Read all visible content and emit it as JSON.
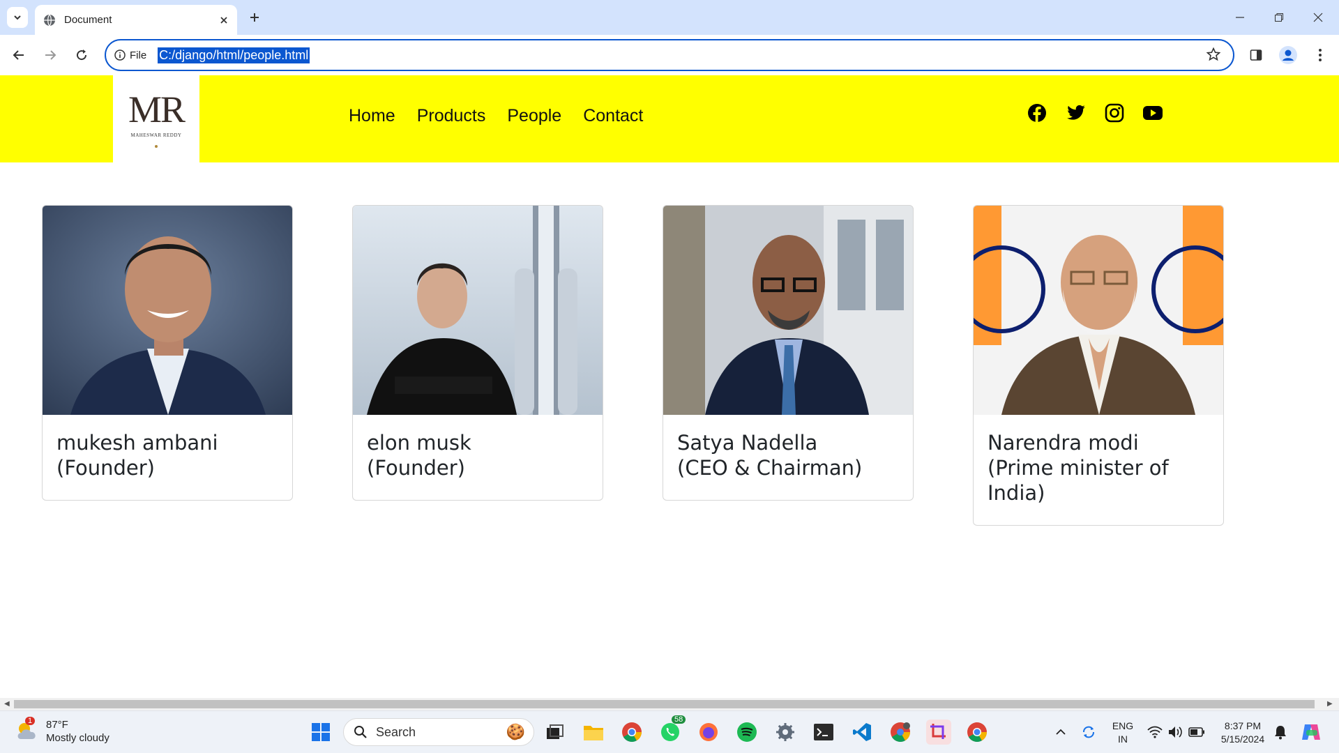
{
  "browser": {
    "tab_title": "Document",
    "site_info_label": "File",
    "url": "C:/django/html/people.html"
  },
  "site": {
    "logo_mark": "MR",
    "logo_name": "MAHESWAR REDDY",
    "nav": [
      "Home",
      "Products",
      "People",
      "Contact"
    ],
    "social": [
      "facebook-icon",
      "twitter-icon",
      "instagram-icon",
      "youtube-icon"
    ],
    "colors": {
      "header_bg": "#ffff00",
      "text": "#212529"
    }
  },
  "people": [
    {
      "name": "mukesh ambani",
      "role": "(Founder)"
    },
    {
      "name": "elon musk",
      "role": "(Founder)"
    },
    {
      "name": "Satya Nadella",
      "role": "(CEO & Chairman)"
    },
    {
      "name": "Narendra modi",
      "role": "(Prime minister of India)"
    }
  ],
  "taskbar": {
    "weather_temp": "87°F",
    "weather_desc": "Mostly cloudy",
    "weather_badge": "1",
    "search_placeholder": "Search",
    "whatsapp_badge": "58",
    "lang": "ENG",
    "region": "IN",
    "time": "8:37 PM",
    "date": "5/15/2024"
  }
}
